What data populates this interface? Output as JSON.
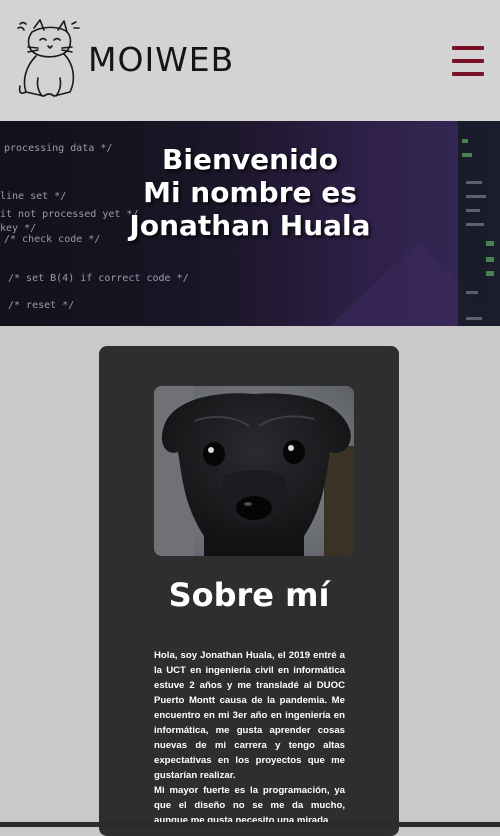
{
  "navbar": {
    "brand": "MOIWEB",
    "menu_icon": "hamburger-menu-icon",
    "logo_icon": "cat-logo-icon"
  },
  "hero": {
    "title_lines": [
      "Bienvenido",
      "Mi nombre es",
      "Jonathan Huala"
    ],
    "background_code_lines": [
      "processing data */",
      "line set */",
      "it not processed yet */",
      "key */",
      "/* check code */",
      "/* set B(4) if correct code */",
      "/* reset */"
    ]
  },
  "about": {
    "title": "Sobre mí",
    "paragraph_1": "Hola, soy Jonathan Huala, el 2019 entré a la UCT en ingeniería civil en informática estuve 2 años y me transladé al DUOC Puerto Montt causa de la pandemia. Me encuentro en mi 3er año en ingeniería en informática, me gusta aprender cosas nuevas de mi carrera y tengo altas expectativas en los proyectos que me gustarían realizar.",
    "paragraph_2": "Mi mayor fuerte es la programación, ya que el diseño no se me da mucho, aunque me gusta necesito una mirada"
  },
  "colors": {
    "navbar_bg": "#d3d3d3",
    "accent": "#7a1028",
    "card_bg": "#2e2e2e",
    "page_bg": "#c9c9c9"
  }
}
